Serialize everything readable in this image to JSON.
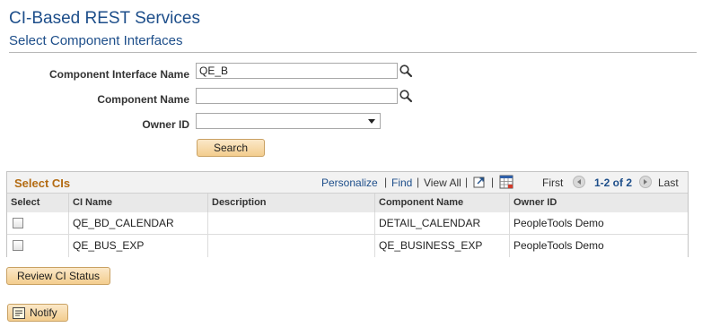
{
  "header": {
    "title": "CI-Based REST Services",
    "subtitle": "Select Component Interfaces"
  },
  "form": {
    "ci_name_label": "Component Interface Name",
    "ci_name_value": "QE_B",
    "component_name_label": "Component Name",
    "component_name_value": "",
    "owner_id_label": "Owner ID",
    "owner_id_value": "",
    "search_label": "Search"
  },
  "grid": {
    "title": "Select CIs",
    "personalize": "Personalize",
    "find": "Find",
    "view_all": "View All",
    "first": "First",
    "range": "1-2 of 2",
    "last": "Last",
    "columns": [
      "Select",
      "CI Name",
      "Description",
      "Component Name",
      "Owner ID"
    ],
    "rows": [
      {
        "ci_name": "QE_BD_CALENDAR",
        "description": "",
        "component_name": "DETAIL_CALENDAR",
        "owner_id": "PeopleTools Demo"
      },
      {
        "ci_name": "QE_BUS_EXP",
        "description": "",
        "component_name": "QE_BUSINESS_EXP",
        "owner_id": "PeopleTools Demo"
      }
    ]
  },
  "actions": {
    "review_label": "Review CI Status",
    "notify_label": "Notify"
  },
  "icons": {
    "lookup": "magnifier-icon",
    "zoom": "zoom-icon",
    "download": "grid-download-icon",
    "prev": "previous-arrow-icon",
    "next": "next-arrow-icon",
    "notify": "notify-icon"
  },
  "colors": {
    "title": "#1d4e8a",
    "grid_title": "#b36b12",
    "button": "#f3cd8e"
  }
}
